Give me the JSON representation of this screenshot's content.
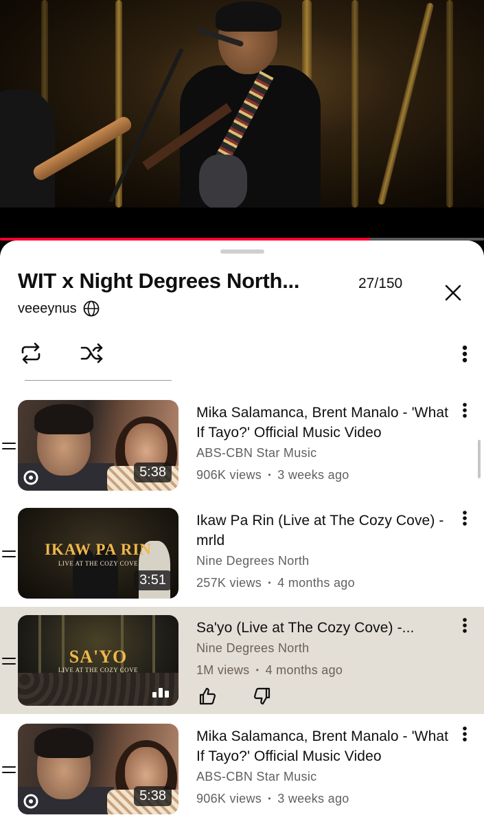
{
  "player": {
    "progress_fraction": 0.765,
    "accent": "#ff0033"
  },
  "playlist": {
    "title": "WIT x Night Degrees North...",
    "count": "27/150",
    "owner": "veeeynus",
    "icons": {
      "close": "close-icon",
      "visibility": "globe-icon",
      "loop": "repeat-icon",
      "shuffle": "shuffle-icon",
      "more": "more-vertical-icon"
    }
  },
  "videos": [
    {
      "title": "Mika Salamanca, Brent Manalo - 'What If Tayo?' Official Music Video",
      "channel": "ABS-CBN Star Music",
      "views": "906K views",
      "age": "3 weeks ago",
      "duration": "5:38",
      "thumb_style": "mika",
      "active": false
    },
    {
      "title": "Ikaw Pa Rin (Live at The Cozy Cove) - mrld",
      "channel": "Nine Degrees North",
      "views": "257K views",
      "age": "4 months ago",
      "duration": "3:51",
      "thumb_style": "ikaw",
      "thumb_title": "IKAW PA RIN",
      "thumb_sub": "LIVE AT THE COZY COVE",
      "active": false
    },
    {
      "title": "Sa'yo (Live at The Cozy Cove) -...",
      "channel": "Nine Degrees North",
      "views": "1M views",
      "age": "4 months ago",
      "duration": "",
      "thumb_style": "sayo",
      "thumb_title": "SA'YO",
      "thumb_sub": "LIVE AT THE COZY COVE",
      "active": true,
      "now_playing_icon": "equalizer-icon",
      "like_icon": "thumbs-up-icon",
      "dislike_icon": "thumbs-down-icon"
    },
    {
      "title": "Mika Salamanca, Brent Manalo - 'What If Tayo?' Official Music Video",
      "channel": "ABS-CBN Star Music",
      "views": "906K views",
      "age": "3 weeks ago",
      "duration": "5:38",
      "thumb_style": "mika",
      "active": false
    }
  ],
  "meta_separator": "•"
}
